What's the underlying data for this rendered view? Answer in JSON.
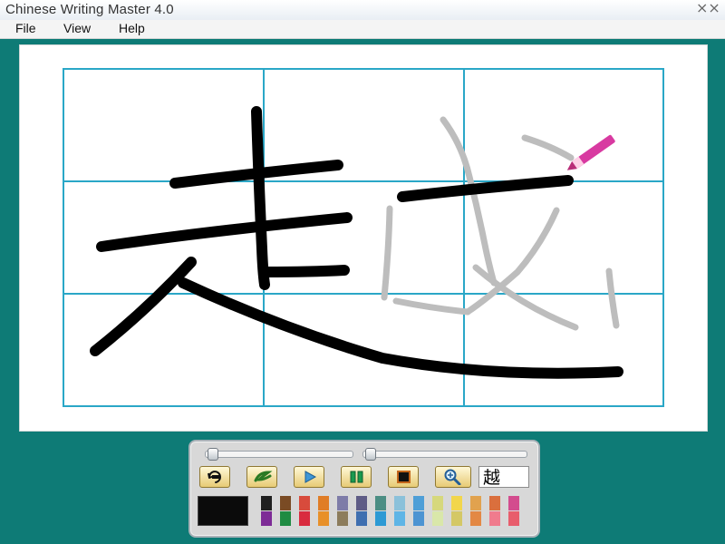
{
  "window": {
    "title": "Chinese Writing Master 4.0",
    "close_glyph": "⨯⨯"
  },
  "menu": {
    "items": [
      "File",
      "View",
      "Help"
    ]
  },
  "canvas": {
    "grid_color": "#2aa7c7",
    "ghost_color": "#bdbdbd",
    "stroke_color": "#000000",
    "pencil_color": "#d83aa1"
  },
  "toolbar": {
    "current_character": "越",
    "current_color": "#0b0b0b",
    "buttons": [
      {
        "name": "rewind-icon"
      },
      {
        "name": "brush-icon"
      },
      {
        "name": "play-icon"
      },
      {
        "name": "pause-icon"
      },
      {
        "name": "stop-icon"
      },
      {
        "name": "magnifier-icon"
      }
    ],
    "palette": [
      "#1f1f1f",
      "#7a4b24",
      "#d84b3c",
      "#e07d26",
      "#7e7ca8",
      "#5f5c86",
      "#4c8e84",
      "#8bc1da",
      "#4f9fd7",
      "#d6d87c",
      "#f2d64c",
      "#e1a24e",
      "#da6f3d",
      "#d34c8e",
      "#7d2b96",
      "#1f8b42",
      "#d92b3f",
      "#e89029",
      "#8c7c5c",
      "#3f6fb0",
      "#2d9ad4",
      "#5eb5e6",
      "#4d94d2",
      "#d9e7aa",
      "#d4c866",
      "#e38844",
      "#f07b8d",
      "#e85d6c"
    ]
  }
}
